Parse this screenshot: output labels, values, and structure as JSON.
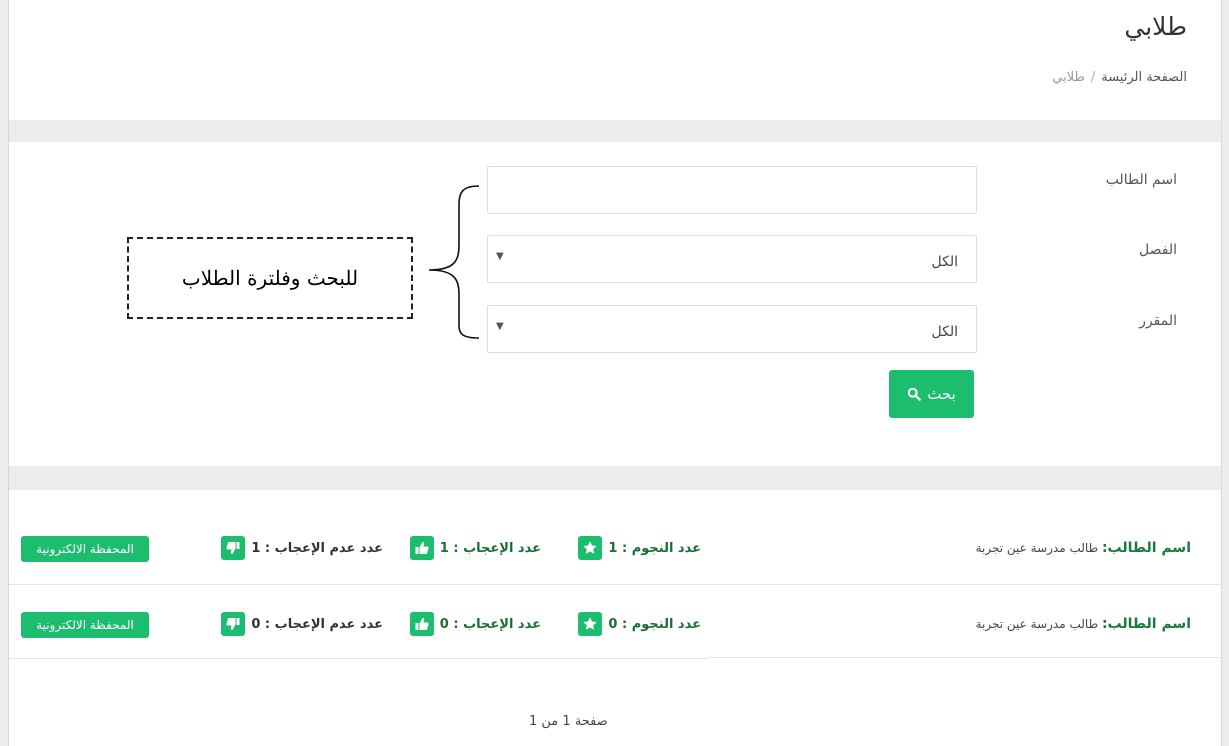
{
  "header": {
    "title": "طلابي",
    "breadcrumb": {
      "home": "الصفحة الرئيسة",
      "separator": "/",
      "current": "طلابي"
    }
  },
  "filters": {
    "student_name": {
      "label": "اسم الطالب",
      "value": "",
      "placeholder": ""
    },
    "class": {
      "label": "الفصل",
      "value": "الكل"
    },
    "course": {
      "label": "المقرر",
      "value": "الكل"
    },
    "search_button": "بحث"
  },
  "callout": {
    "text": "للبحث وفلترة الطلاب"
  },
  "students": [
    {
      "name_label": "اسم الطالب:",
      "name": "طالب مدرسة عين تجربة",
      "stars": "عدد النجوم : 1",
      "likes": "عدد الإعجاب : 1",
      "dislikes": "عدد عدم الإعجاب : 1",
      "portfolio_button": "المحفظة الالكترونية"
    },
    {
      "name_label": "اسم الطالب:",
      "name": "طالب مدرسة عين تجربة",
      "stars": "عدد النجوم : 0",
      "likes": "عدد الإعجاب : 0",
      "dislikes": "عدد عدم الإعجاب : 0",
      "portfolio_button": "المحفظة الالكترونية"
    }
  ],
  "pagination": {
    "text": "صفحة 1 من 1"
  },
  "colors": {
    "accent": "#1dbd70",
    "label_green": "#1a6e33",
    "band": "#ececec"
  },
  "icons": [
    "search-icon",
    "star-icon",
    "thumbs-up-icon",
    "thumbs-down-icon",
    "chevron-down-icon"
  ]
}
